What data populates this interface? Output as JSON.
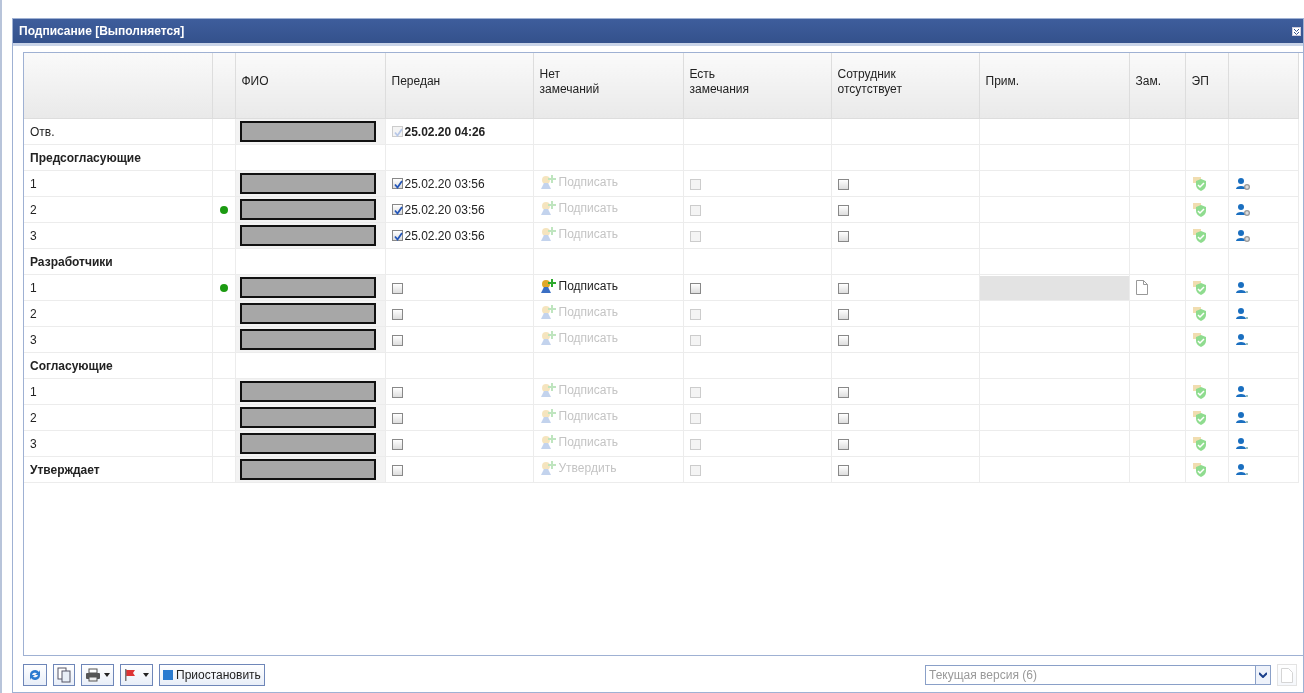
{
  "window": {
    "title": "Подписание [Выполняется]"
  },
  "table": {
    "columns": [
      {
        "label": "ФИО"
      },
      {
        "label": "Передан"
      },
      {
        "label": "Нет замечаний"
      },
      {
        "label": "Есть замечания"
      },
      {
        "label": "Сотрудник отсутствует"
      },
      {
        "label": "Прим."
      },
      {
        "label": "Зам."
      },
      {
        "label": "ЭП"
      }
    ],
    "rows": [
      {
        "kind": "responsible",
        "label": "Отв.",
        "label_bold": false,
        "online": false,
        "transferred": {
          "checked": true,
          "disabled": true,
          "date": "25.02.20 04:26"
        }
      },
      {
        "kind": "section",
        "label": "Предсогласующие"
      },
      {
        "kind": "person",
        "label": "1",
        "label_bold": false,
        "online": false,
        "transferred": {
          "checked": true,
          "disabled": false,
          "date": "25.02.20 03:56"
        },
        "action": {
          "label": "Подписать",
          "enabled": false
        },
        "remarks": {
          "checked": false,
          "disabled": true
        },
        "absent": {
          "checked": false,
          "disabled": false
        },
        "note_field": false,
        "document": false,
        "signature": true,
        "user_badge": true
      },
      {
        "kind": "person",
        "label": "2",
        "label_bold": false,
        "online": true,
        "transferred": {
          "checked": true,
          "disabled": false,
          "date": "25.02.20 03:56"
        },
        "action": {
          "label": "Подписать",
          "enabled": false
        },
        "remarks": {
          "checked": false,
          "disabled": true
        },
        "absent": {
          "checked": false,
          "disabled": false
        },
        "note_field": false,
        "document": false,
        "signature": true,
        "user_badge": true
      },
      {
        "kind": "person",
        "label": "3",
        "label_bold": false,
        "online": false,
        "transferred": {
          "checked": true,
          "disabled": false,
          "date": "25.02.20 03:56"
        },
        "action": {
          "label": "Подписать",
          "enabled": false
        },
        "remarks": {
          "checked": false,
          "disabled": true
        },
        "absent": {
          "checked": false,
          "disabled": false
        },
        "note_field": false,
        "document": false,
        "signature": true,
        "user_badge": true
      },
      {
        "kind": "section",
        "label": "Разработчики"
      },
      {
        "kind": "person",
        "label": "1",
        "label_bold": false,
        "online": true,
        "transferred": {
          "checked": false,
          "disabled": false
        },
        "action": {
          "label": "Подписать",
          "enabled": true
        },
        "remarks": {
          "checked": false,
          "disabled": false
        },
        "absent": {
          "checked": false,
          "disabled": false
        },
        "note_field": true,
        "document": true,
        "signature": true,
        "user_badge": false
      },
      {
        "kind": "person",
        "label": "2",
        "label_bold": false,
        "online": false,
        "transferred": {
          "checked": false,
          "disabled": false
        },
        "action": {
          "label": "Подписать",
          "enabled": false
        },
        "remarks": {
          "checked": false,
          "disabled": true
        },
        "absent": {
          "checked": false,
          "disabled": false
        },
        "note_field": false,
        "document": false,
        "signature": true,
        "user_badge": false
      },
      {
        "kind": "person",
        "label": "3",
        "label_bold": false,
        "online": false,
        "transferred": {
          "checked": false,
          "disabled": false
        },
        "action": {
          "label": "Подписать",
          "enabled": false
        },
        "remarks": {
          "checked": false,
          "disabled": true
        },
        "absent": {
          "checked": false,
          "disabled": false
        },
        "note_field": false,
        "document": false,
        "signature": true,
        "user_badge": false
      },
      {
        "kind": "section",
        "label": "Согласующие"
      },
      {
        "kind": "person",
        "label": "1",
        "label_bold": false,
        "online": false,
        "transferred": {
          "checked": false,
          "disabled": false
        },
        "action": {
          "label": "Подписать",
          "enabled": false
        },
        "remarks": {
          "checked": false,
          "disabled": true
        },
        "absent": {
          "checked": false,
          "disabled": false
        },
        "note_field": false,
        "document": false,
        "signature": true,
        "user_badge": false
      },
      {
        "kind": "person",
        "label": "2",
        "label_bold": false,
        "online": false,
        "transferred": {
          "checked": false,
          "disabled": false
        },
        "action": {
          "label": "Подписать",
          "enabled": false
        },
        "remarks": {
          "checked": false,
          "disabled": true
        },
        "absent": {
          "checked": false,
          "disabled": false
        },
        "note_field": false,
        "document": false,
        "signature": true,
        "user_badge": false
      },
      {
        "kind": "person",
        "label": "3",
        "label_bold": false,
        "online": false,
        "transferred": {
          "checked": false,
          "disabled": false
        },
        "action": {
          "label": "Подписать",
          "enabled": false
        },
        "remarks": {
          "checked": false,
          "disabled": true
        },
        "absent": {
          "checked": false,
          "disabled": false
        },
        "note_field": false,
        "document": false,
        "signature": true,
        "user_badge": false
      },
      {
        "kind": "person",
        "label": "Утверждает",
        "label_bold": true,
        "online": false,
        "transferred": {
          "checked": false,
          "disabled": false
        },
        "action": {
          "label": "Утвердить",
          "enabled": false
        },
        "remarks": {
          "checked": false,
          "disabled": true
        },
        "absent": {
          "checked": false,
          "disabled": false
        },
        "note_field": false,
        "document": false,
        "signature": true,
        "user_badge": false
      }
    ]
  },
  "toolbar": {
    "pause_button": "Приостановить",
    "version_select": {
      "value": "Текущая версия (6)"
    }
  }
}
